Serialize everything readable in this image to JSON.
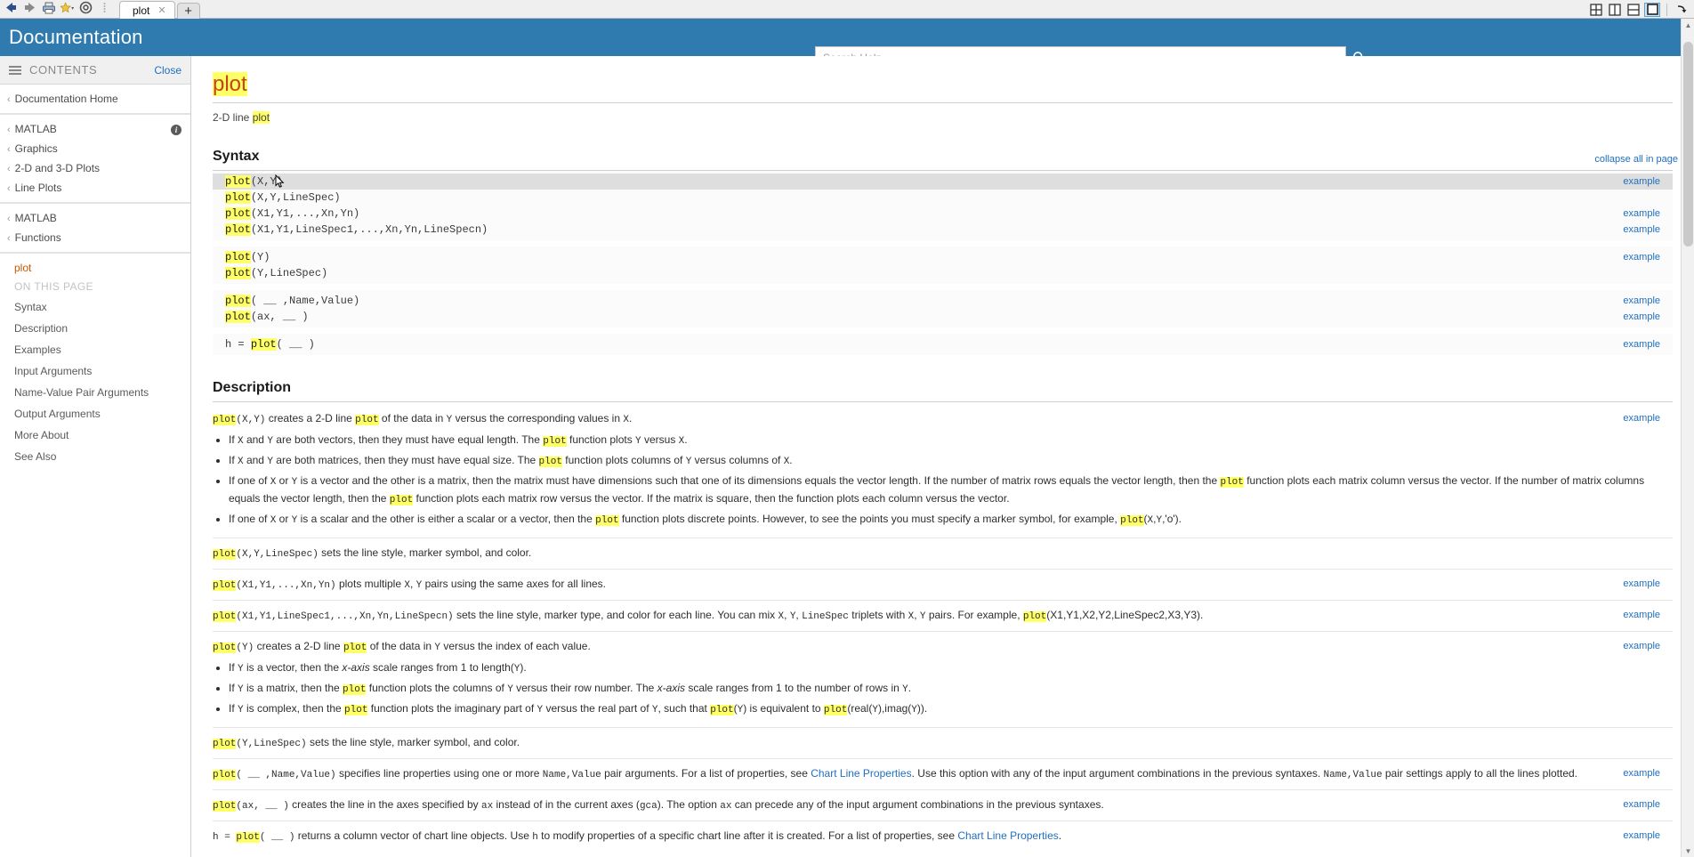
{
  "browser": {
    "toolbar_icons": [
      "back-arrow-icon",
      "forward-arrow-icon",
      "print-icon",
      "favorites-star-icon",
      "gear-icon",
      "grip-handle-icon"
    ],
    "tab": {
      "title": "plot",
      "close_label": "✕"
    },
    "new_tab_label": "+",
    "layout_buttons": [
      {
        "name": "layout-quad",
        "selected": false
      },
      {
        "name": "layout-two-vertical",
        "selected": false
      },
      {
        "name": "layout-two-horizontal",
        "selected": false
      },
      {
        "name": "layout-single",
        "selected": true
      }
    ],
    "undock_icon": "undock-arrow-icon"
  },
  "header": {
    "title": "Documentation",
    "search_placeholder": "Search Help",
    "search_value": "",
    "search_icon": "search-icon",
    "accent_color": "#2f7aae"
  },
  "sidebar": {
    "contents_label": "CONTENTS",
    "close_label": "Close",
    "home": "Documentation Home",
    "breadcrumbs_1": [
      "MATLAB",
      "Graphics",
      "2-D and 3-D Plots",
      "Line Plots"
    ],
    "breadcrumbs_2": [
      "MATLAB",
      "Functions"
    ],
    "current_page": "plot",
    "on_this_page_label": "ON THIS PAGE",
    "on_this_page": [
      "Syntax",
      "Description",
      "Examples",
      "Input Arguments",
      "Name-Value Pair Arguments",
      "Output Arguments",
      "More About",
      "See Also"
    ]
  },
  "content": {
    "collapse_all": "collapse all in page",
    "title": "plot",
    "title_highlight": "plot",
    "subtitle_pre": "2-D line ",
    "subtitle_highlight": "plot",
    "syntax_heading": "Syntax",
    "description_heading": "Description",
    "example_link": "example",
    "syntax_groups": [
      {
        "rows": [
          {
            "fn": "plot",
            "args": "(X,Y)",
            "example": true,
            "hover": true
          },
          {
            "fn": "plot",
            "args": "(X,Y,LineSpec)",
            "example": false,
            "hover": false
          },
          {
            "fn": "plot",
            "args": "(X1,Y1,...,Xn,Yn)",
            "example": true,
            "hover": false
          },
          {
            "fn": "plot",
            "args": "(X1,Y1,LineSpec1,...,Xn,Yn,LineSpecn)",
            "example": true,
            "hover": false
          }
        ]
      },
      {
        "rows": [
          {
            "fn": "plot",
            "args": "(Y)",
            "example": true,
            "hover": false
          },
          {
            "fn": "plot",
            "args": "(Y,LineSpec)",
            "example": false,
            "hover": false
          }
        ]
      },
      {
        "rows": [
          {
            "fn": "plot",
            "args": "( __ ,Name,Value)",
            "example": true,
            "hover": false
          },
          {
            "fn": "plot",
            "args": "(ax, __ )",
            "example": true,
            "hover": false
          }
        ]
      },
      {
        "rows": [
          {
            "prefix": "h = ",
            "fn": "plot",
            "args": "( __ )",
            "example": true,
            "hover": false
          }
        ]
      }
    ]
  },
  "descriptions": [
    {
      "id": "desc-xy",
      "example": true,
      "lead_fn": "plot",
      "lead_args": "(X,Y)",
      "lead_text_parts": [
        "creates a 2-D line ",
        "plot",
        " of the data in ",
        "Y",
        " versus the corresponding values in ",
        "X",
        "."
      ],
      "bullets": [
        "If X and Y are both vectors, then they must have equal length. The plot function plots Y versus X.",
        "If X and Y are both matrices, then they must have equal size. The plot function plots columns of Y versus columns of X.",
        "If one of X or Y is a vector and the other is a matrix, then the matrix must have dimensions such that one of its dimensions equals the vector length. If the number of matrix rows equals the vector length, then the plot function plots each matrix column versus the vector. If the number of matrix columns equals the vector length, then the plot function plots each matrix row versus the vector. If the matrix is square, then the function plots each column versus the vector.",
        "If one of X or Y is a scalar and the other is either a scalar or a vector, then the plot function plots discrete points. However, to see the points you must specify a marker symbol, for example, plot(X,Y,'o')."
      ]
    },
    {
      "id": "desc-xy-linespec",
      "example": false,
      "lead_fn": "plot",
      "lead_args": "(X,Y,LineSpec)",
      "text": "sets the line style, marker symbol, and color."
    },
    {
      "id": "desc-multi",
      "example": true,
      "lead_fn": "plot",
      "lead_args": "(X1,Y1,...,Xn,Yn)",
      "text": "plots multiple X, Y pairs using the same axes for all lines."
    },
    {
      "id": "desc-multi-linespec",
      "example": true,
      "lead_fn": "plot",
      "lead_args": "(X1,Y1,LineSpec1,...,Xn,Yn,LineSpecn)",
      "text": "sets the line style, marker type, and color for each line. You can mix X, Y, LineSpec triplets with X, Y pairs. For example, plot(X1,Y1,X2,Y2,LineSpec2,X3,Y3)."
    },
    {
      "id": "desc-y",
      "example": true,
      "lead_fn": "plot",
      "lead_args": "(Y)",
      "text": "creates a 2-D line plot of the data in Y versus the index of each value.",
      "bullets": [
        "If Y is a vector, then the x-axis scale ranges from 1 to length(Y).",
        "If Y is a matrix, then the plot function plots the columns of Y versus their row number. The x-axis scale ranges from 1 to the number of rows in Y.",
        "If Y is complex, then the plot function plots the imaginary part of Y versus the real part of Y, such that plot(Y) is equivalent to plot(real(Y),imag(Y))."
      ]
    },
    {
      "id": "desc-y-linespec",
      "example": false,
      "lead_fn": "plot",
      "lead_args": "(Y,LineSpec)",
      "text": "sets the line style, marker symbol, and color."
    },
    {
      "id": "desc-namevalue",
      "example": true,
      "lead_fn": "plot",
      "lead_args": "( __ ,Name,Value)",
      "text": "specifies line properties using one or more Name,Value pair arguments. For a list of properties, see Chart Line Properties. Use this option with any of the input argument combinations in the previous syntaxes. Name,Value pair settings apply to all the lines plotted.",
      "link_text": "Chart Line Properties"
    },
    {
      "id": "desc-ax",
      "example": true,
      "lead_fn": "plot",
      "lead_args": "(ax, __ )",
      "text": "creates the line in the axes specified by ax instead of in the current axes (gca). The option ax can precede any of the input argument combinations in the previous syntaxes."
    },
    {
      "id": "desc-handle",
      "example": true,
      "lead_prefix": "h = ",
      "lead_fn": "plot",
      "lead_args": "( __ )",
      "text": "returns a column vector of chart line objects. Use h to modify properties of a specific chart line after it is created. For a list of properties, see Chart Line Properties.",
      "link_text": "Chart Line Properties"
    }
  ]
}
